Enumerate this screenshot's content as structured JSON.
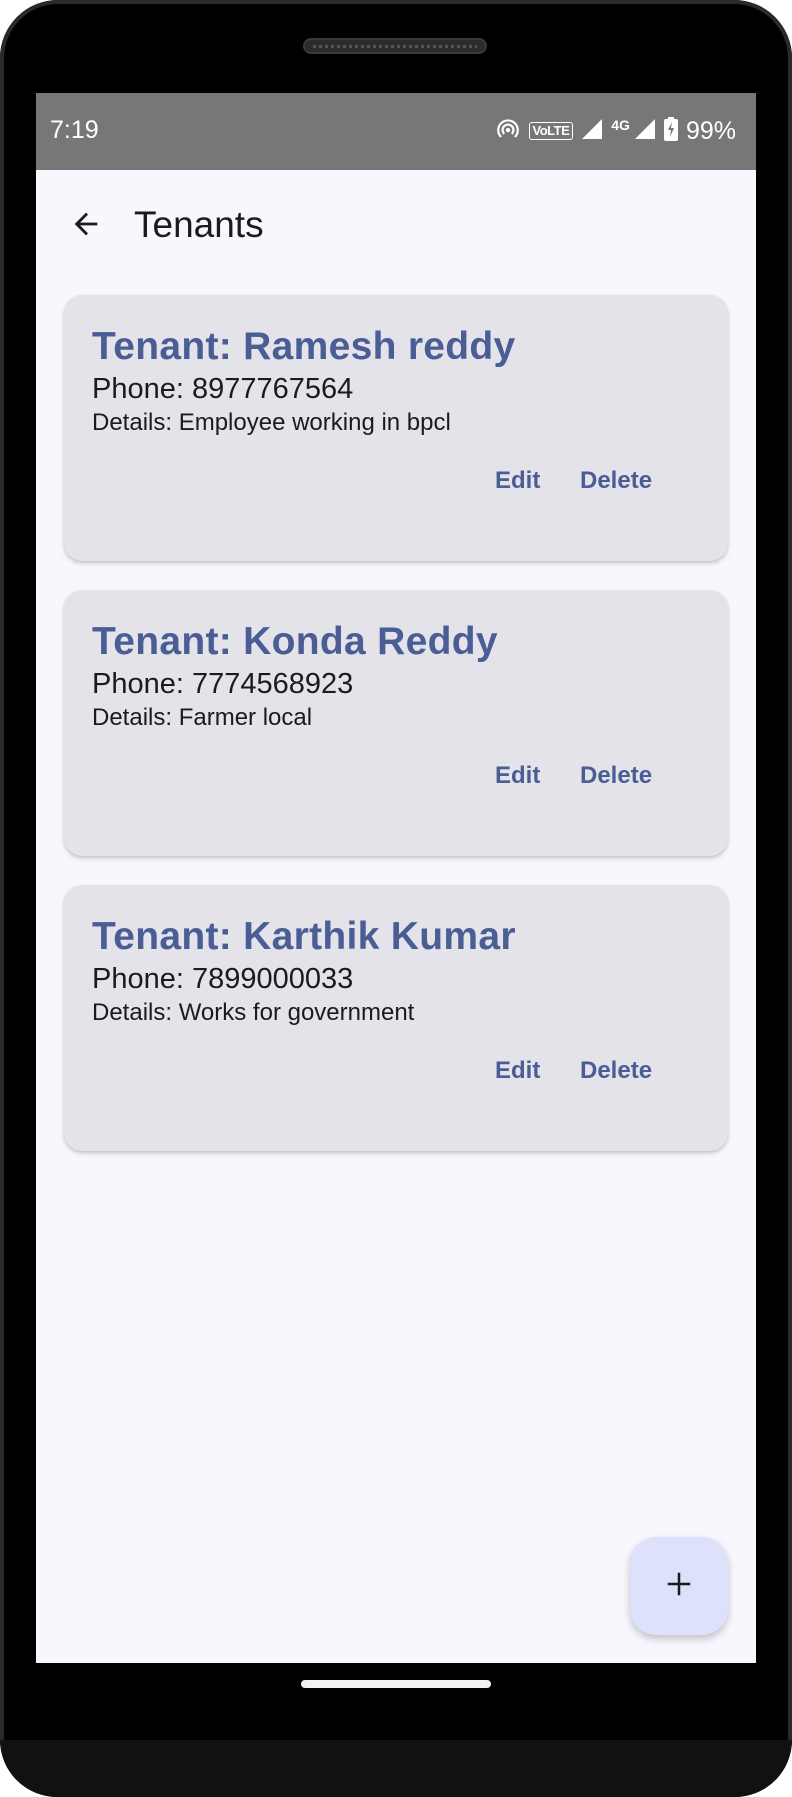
{
  "status_bar": {
    "time": "7:19",
    "volte": "VoLTE",
    "network": "4G",
    "battery": "99%",
    "icons": [
      "hotspot-icon",
      "volte-icon",
      "signal-icon",
      "lte-icon",
      "signal-icon",
      "battery-charging-icon"
    ]
  },
  "header": {
    "title": "Tenants",
    "back_icon": "arrow-back-icon"
  },
  "tenants": [
    {
      "name": "Tenant: Ramesh reddy",
      "phone": "Phone: 8977767564",
      "details": "Details: Employee working in bpcl",
      "edit_label": "Edit",
      "delete_label": "Delete"
    },
    {
      "name": "Tenant: Konda Reddy",
      "phone": "Phone: 7774568923",
      "details": "Details: Farmer local",
      "edit_label": "Edit",
      "delete_label": "Delete"
    },
    {
      "name": "Tenant: Karthik Kumar",
      "phone": "Phone: 7899000033",
      "details": "Details: Works for government",
      "edit_label": "Edit",
      "delete_label": "Delete"
    }
  ],
  "fab": {
    "icon": "plus-icon"
  },
  "colors": {
    "accent": "#4a5d95",
    "card_bg": "#e3e3e9",
    "screen_bg": "#f7f7fd",
    "status_bar_bg": "#777777",
    "fab_bg": "#dde1fa"
  }
}
